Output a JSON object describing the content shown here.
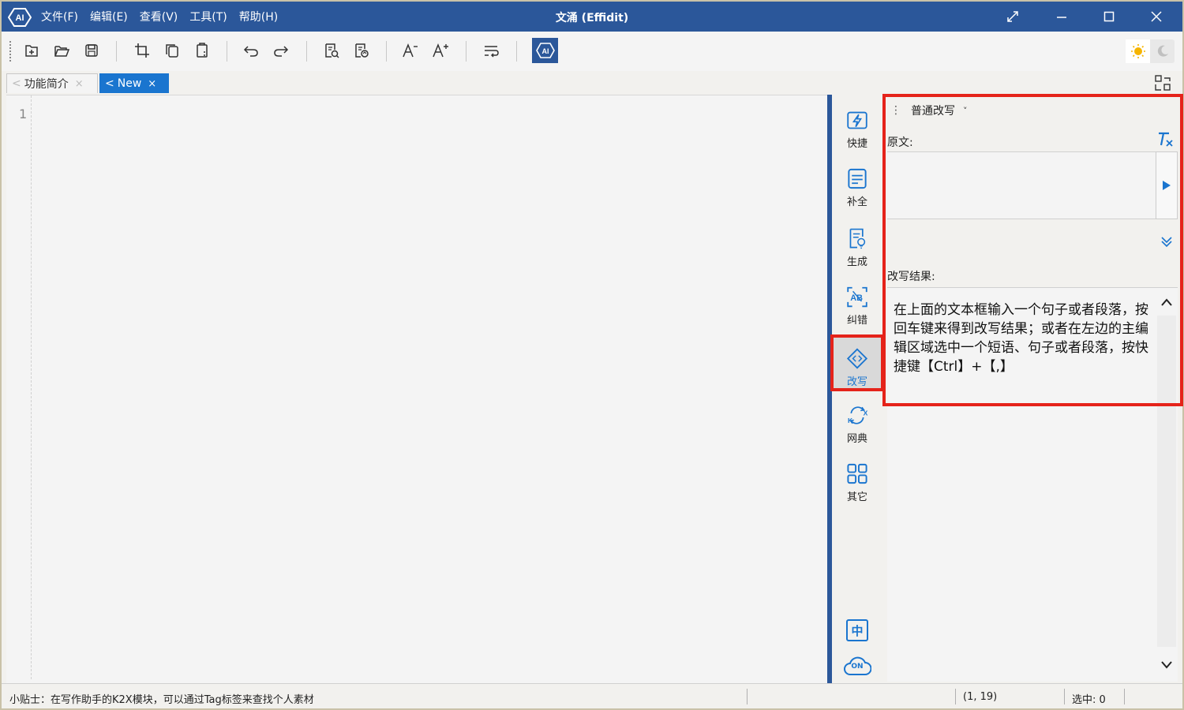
{
  "window": {
    "title": "文涌 (Effidit)",
    "menu": [
      "文件(F)",
      "编辑(E)",
      "查看(V)",
      "工具(T)",
      "帮助(H)"
    ]
  },
  "toolbar": {
    "buttons": [
      "new-file-icon",
      "open-folder-icon",
      "save-icon",
      "crop-icon",
      "copy-icon",
      "paste-icon",
      "undo-icon",
      "redo-icon",
      "doc-search-icon",
      "doc-edit-icon",
      "font-decrease-icon",
      "font-increase-icon",
      "wrap-icon",
      "ai-icon"
    ],
    "theme": [
      "sun-icon",
      "moon-icon"
    ]
  },
  "tabs": [
    {
      "label": "功能简介",
      "prefix": "<",
      "close": "×",
      "active": false
    },
    {
      "label": "New",
      "prefix": "<",
      "close": "×",
      "active": true
    }
  ],
  "editor": {
    "line_numbers": [
      "1"
    ]
  },
  "sidenav": {
    "items": [
      {
        "label": "快捷",
        "icon": "lightning-icon"
      },
      {
        "label": "补全",
        "icon": "complete-icon"
      },
      {
        "label": "生成",
        "icon": "generate-icon"
      },
      {
        "label": "纠错",
        "icon": "correct-icon"
      },
      {
        "label": "改写",
        "icon": "rewrite-icon",
        "active": true
      },
      {
        "label": "网典",
        "icon": "dictionary-icon"
      },
      {
        "label": "其它",
        "icon": "grid-icon"
      }
    ],
    "lang_icon_text": "中",
    "cloud_icon_text": "ON"
  },
  "panel": {
    "mode": "普通改写",
    "mode_chevron": "˅",
    "source_label": "原文:",
    "result_label": "改写结果:",
    "result_text": "在上面的文本框输入一个句子或者段落，按回车键来得到改写结果；或者在左边的主编辑区域选中一个短语、句子或者段落，按快捷键【Ctrl】+【,】"
  },
  "status": {
    "tip": "小贴士：在写作助手的K2X模块，可以通过Tag标签来查找个人素材",
    "position": "(1, 19)",
    "selection": "选中: 0"
  },
  "colors": {
    "titlebar": "#2b579a",
    "accent": "#1a75cf",
    "highlight": "#e5231a"
  }
}
